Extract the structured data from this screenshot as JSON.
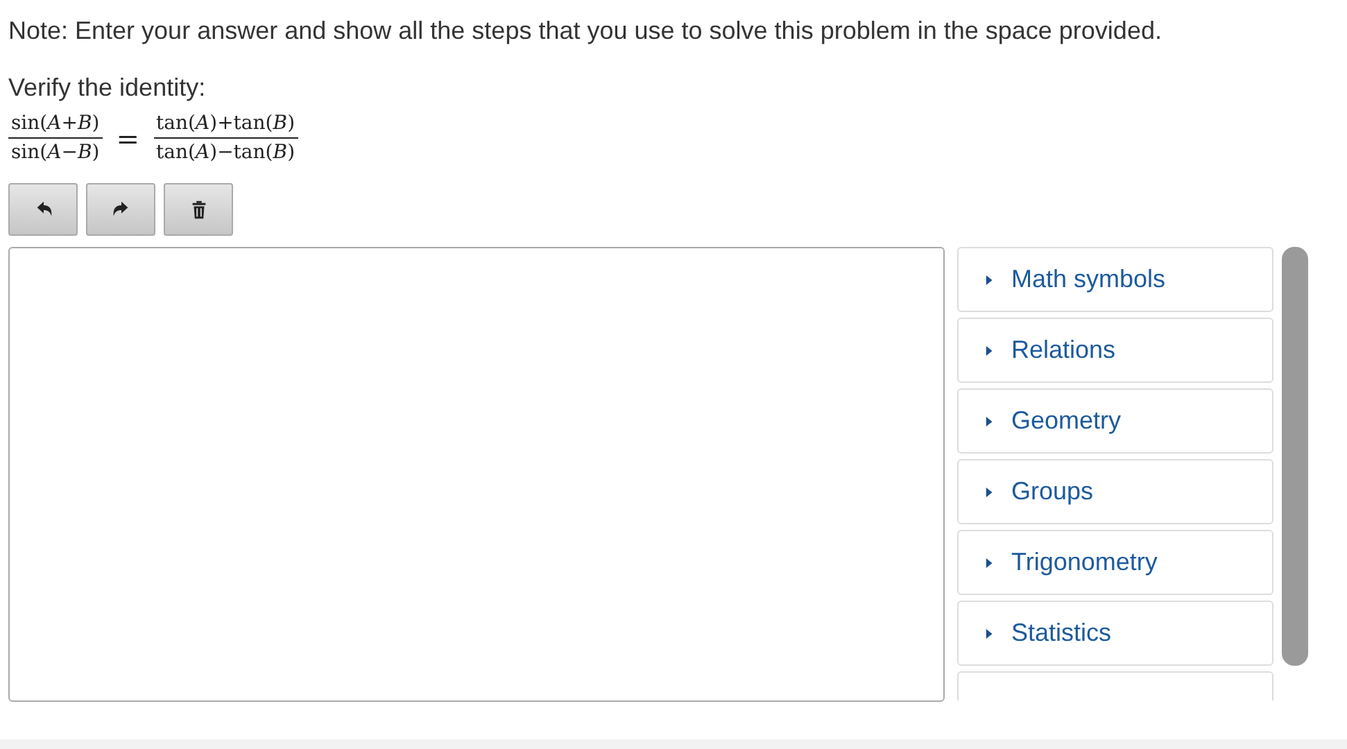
{
  "note": "Note: Enter your answer and show all the steps that you use to solve this problem in the space provided.",
  "prompt": "Verify the identity:",
  "identity": {
    "left": {
      "numerator": "sin(*A*+*B*)",
      "denominator": "sin(*A*−*B*)"
    },
    "equals": "=",
    "right": {
      "numerator": "tan(*A*)+tan(*B*)",
      "denominator": "tan(*A*)−tan(*B*)"
    }
  },
  "toolbar": [
    {
      "kind": "undo"
    },
    {
      "kind": "redo"
    },
    {
      "kind": "delete"
    }
  ],
  "palette": [
    {
      "label": "Math symbols",
      "expanded": false
    },
    {
      "label": "Relations",
      "expanded": false
    },
    {
      "label": "Geometry",
      "expanded": false
    },
    {
      "label": "Groups",
      "expanded": false
    },
    {
      "label": "Trigonometry",
      "expanded": false
    },
    {
      "label": "Statistics",
      "expanded": false
    }
  ]
}
